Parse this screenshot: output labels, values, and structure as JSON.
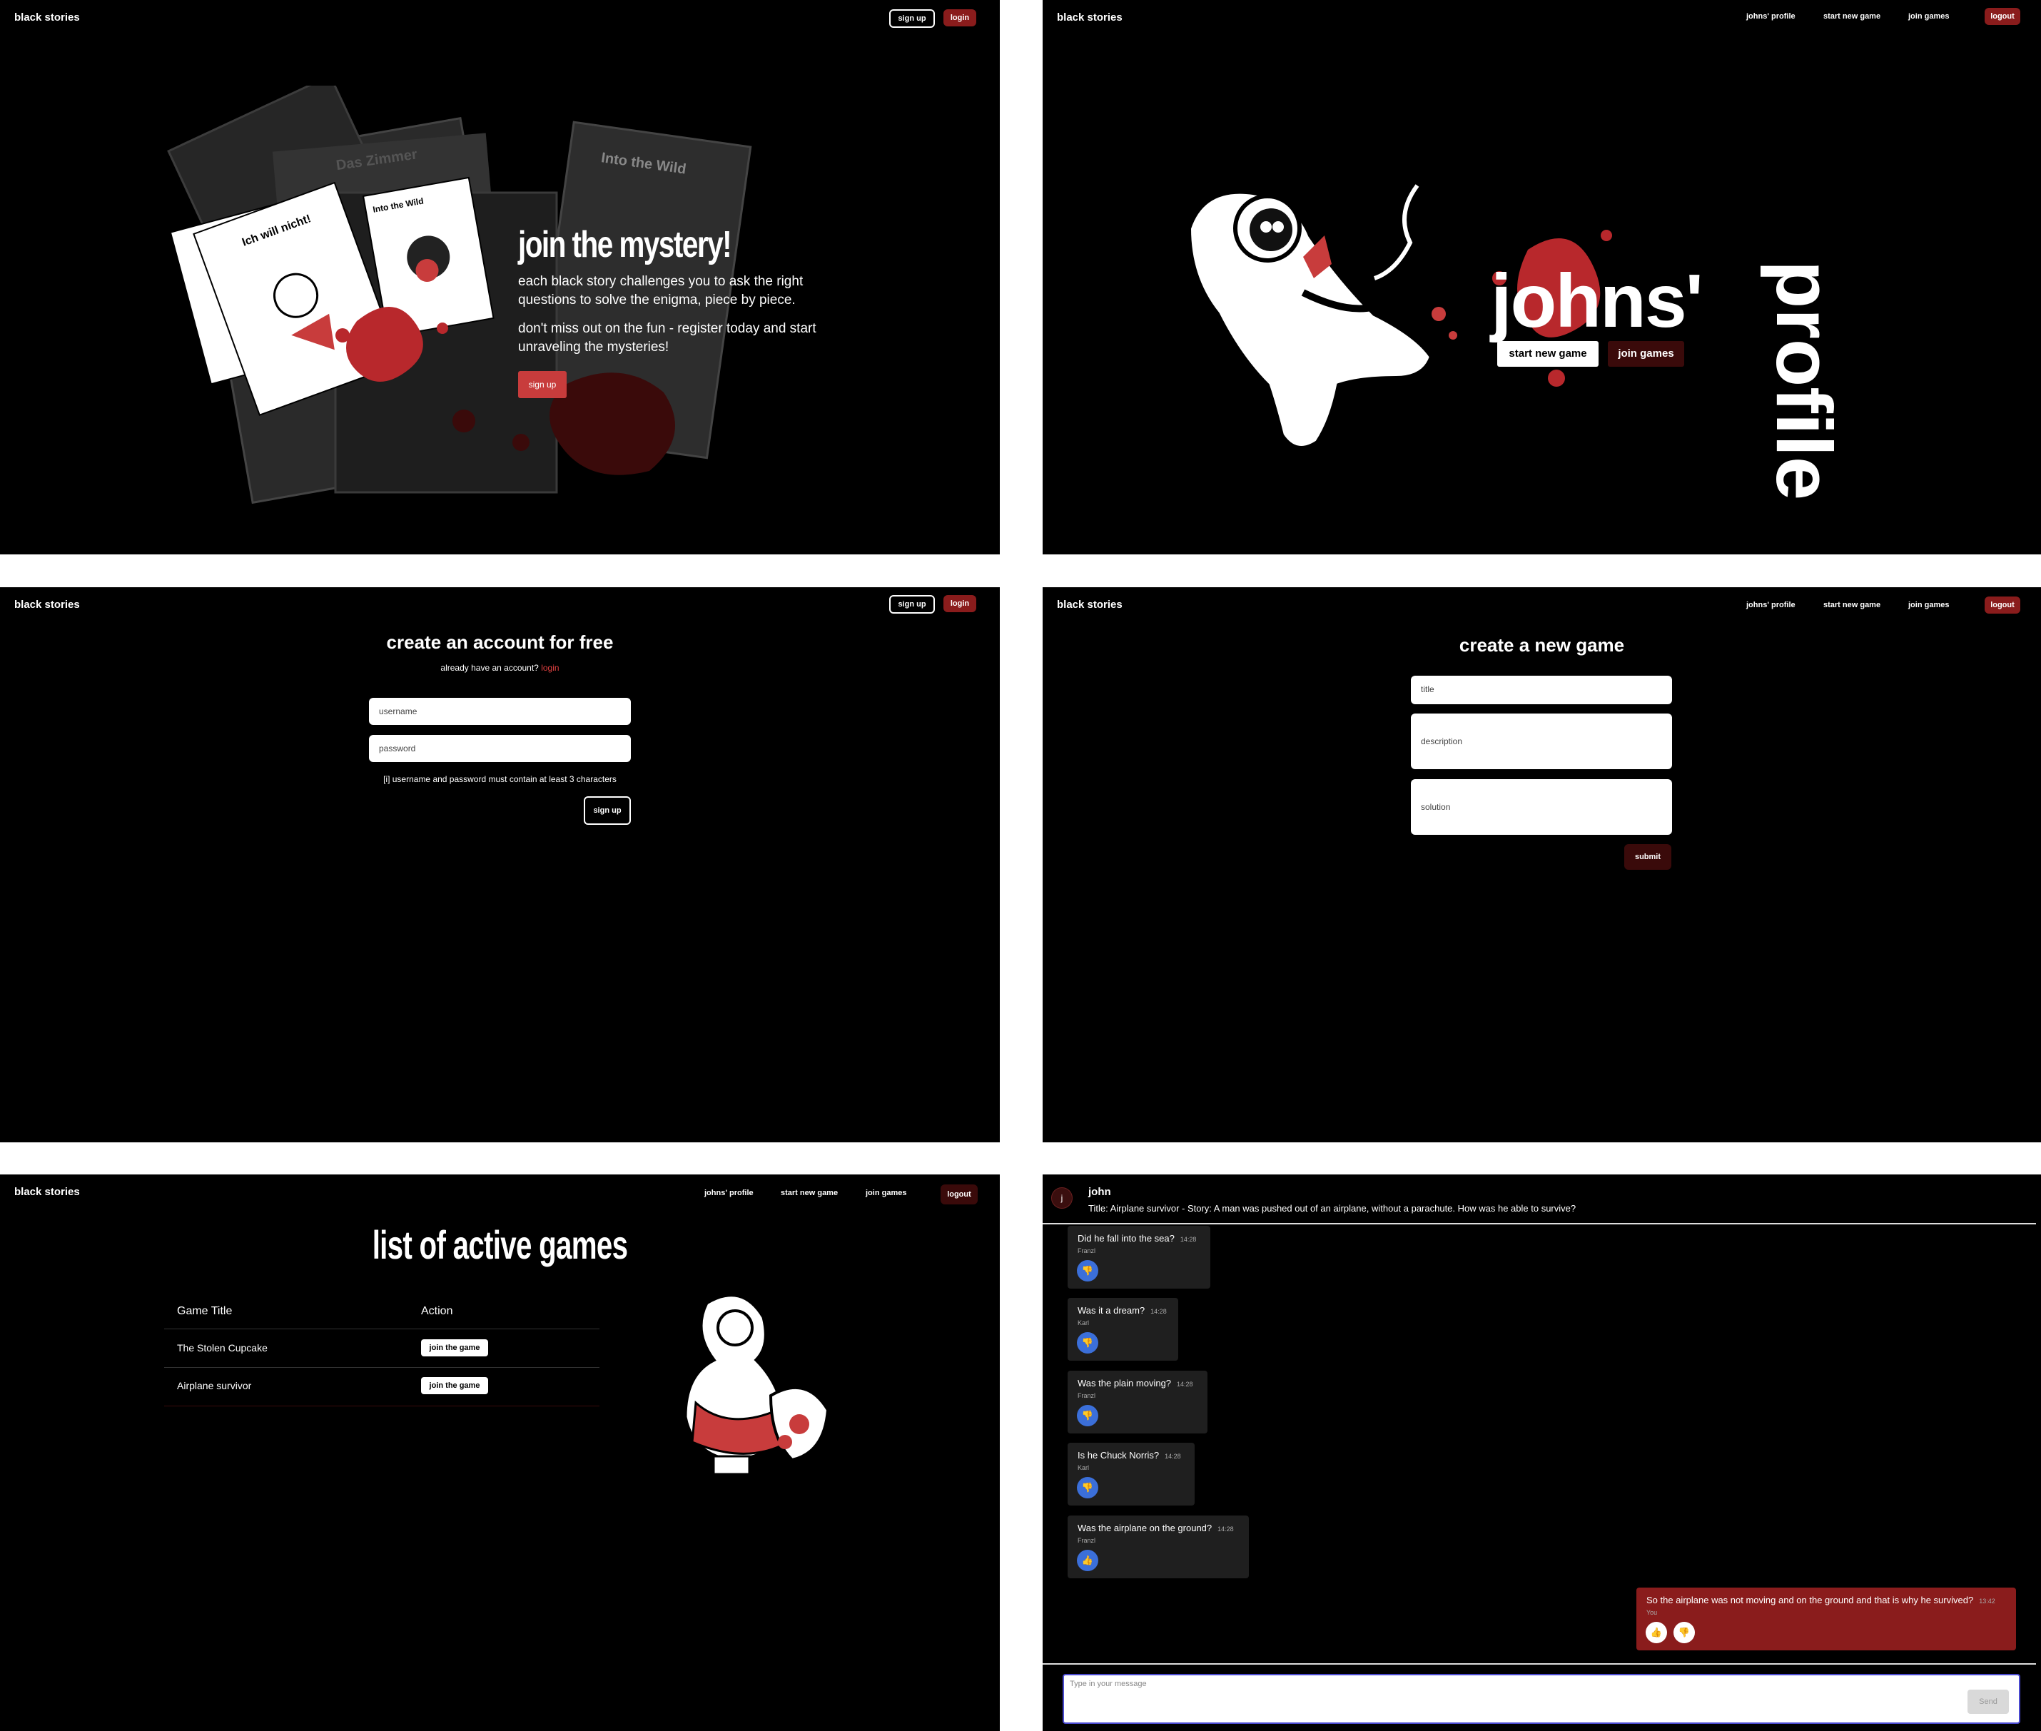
{
  "brand": "black stories",
  "landing": {
    "nav": {
      "signup": "sign up",
      "login": "login"
    },
    "headline": "join the mystery!",
    "paragraph1": "each black story challenges you to ask the right questions to solve the enigma, piece by piece.",
    "paragraph2": "don't miss out on the fun - register today and start unraveling the mysteries!",
    "cta": "sign up",
    "card_titles": [
      "Das Zimmer",
      "Into the Wild",
      "Ich will nicht!",
      "Into the Wild",
      "Das Zimmer"
    ]
  },
  "profile": {
    "nav": {
      "profile": "johns' profile",
      "new_game": "start new game",
      "join": "join games",
      "logout": "logout"
    },
    "name": "johns'",
    "word": "profile",
    "start_btn": "start new game",
    "join_btn": "join games"
  },
  "signup": {
    "nav": {
      "signup": "sign up",
      "login": "login"
    },
    "title": "create an account for free",
    "sub_prefix": "already have an account?",
    "sub_link": "login",
    "username_placeholder": "username",
    "password_placeholder": "password",
    "hint": "[i] username and password must contain at least 3 characters",
    "submit": "sign up"
  },
  "new_game": {
    "nav": {
      "profile": "johns' profile",
      "new_game": "start new game",
      "join": "join games",
      "logout": "logout"
    },
    "title": "create a new game",
    "title_placeholder": "title",
    "description_placeholder": "description",
    "solution_placeholder": "solution",
    "submit": "submit"
  },
  "games_list": {
    "nav": {
      "profile": "johns' profile",
      "new_game": "start new game",
      "join": "join games",
      "logout": "logout"
    },
    "title": "list of active games",
    "col_title": "Game Title",
    "col_action": "Action",
    "rows": [
      {
        "title": "The Stolen Cupcake",
        "action": "join the game"
      },
      {
        "title": "Airplane survivor",
        "action": "join the game"
      }
    ]
  },
  "chat": {
    "avatar_letter": "j",
    "user": "john",
    "description": "Title: Airplane survivor - Story: A man was pushed out of an airplane, without a parachute. How was he able to survive?",
    "messages": [
      {
        "text": "Did he fall into the sea?",
        "time": "14:28",
        "user": "Franzl",
        "reaction": "thumbs-down"
      },
      {
        "text": "Was it a dream?",
        "time": "14:28",
        "user": "Karl",
        "reaction": "thumbs-down"
      },
      {
        "text": "Was the plain moving?",
        "time": "14:28",
        "user": "Franzl",
        "reaction": "thumbs-down"
      },
      {
        "text": "Is he Chuck Norris?",
        "time": "14:28",
        "user": "Karl",
        "reaction": "thumbs-down"
      },
      {
        "text": "Was the airplane on the ground?",
        "time": "14:28",
        "user": "Franzl",
        "reaction": "thumbs-up"
      }
    ],
    "my_message": {
      "text": "So the airplane was not moving and on the ground and that is why he survived?",
      "time": "13:42",
      "user": "You"
    },
    "input_placeholder": "Type in your message",
    "send": "Send"
  },
  "colors": {
    "accent_red": "#8a1c1c",
    "cta_red": "#c83c3c",
    "reaction_blue": "#3b6fd9"
  }
}
